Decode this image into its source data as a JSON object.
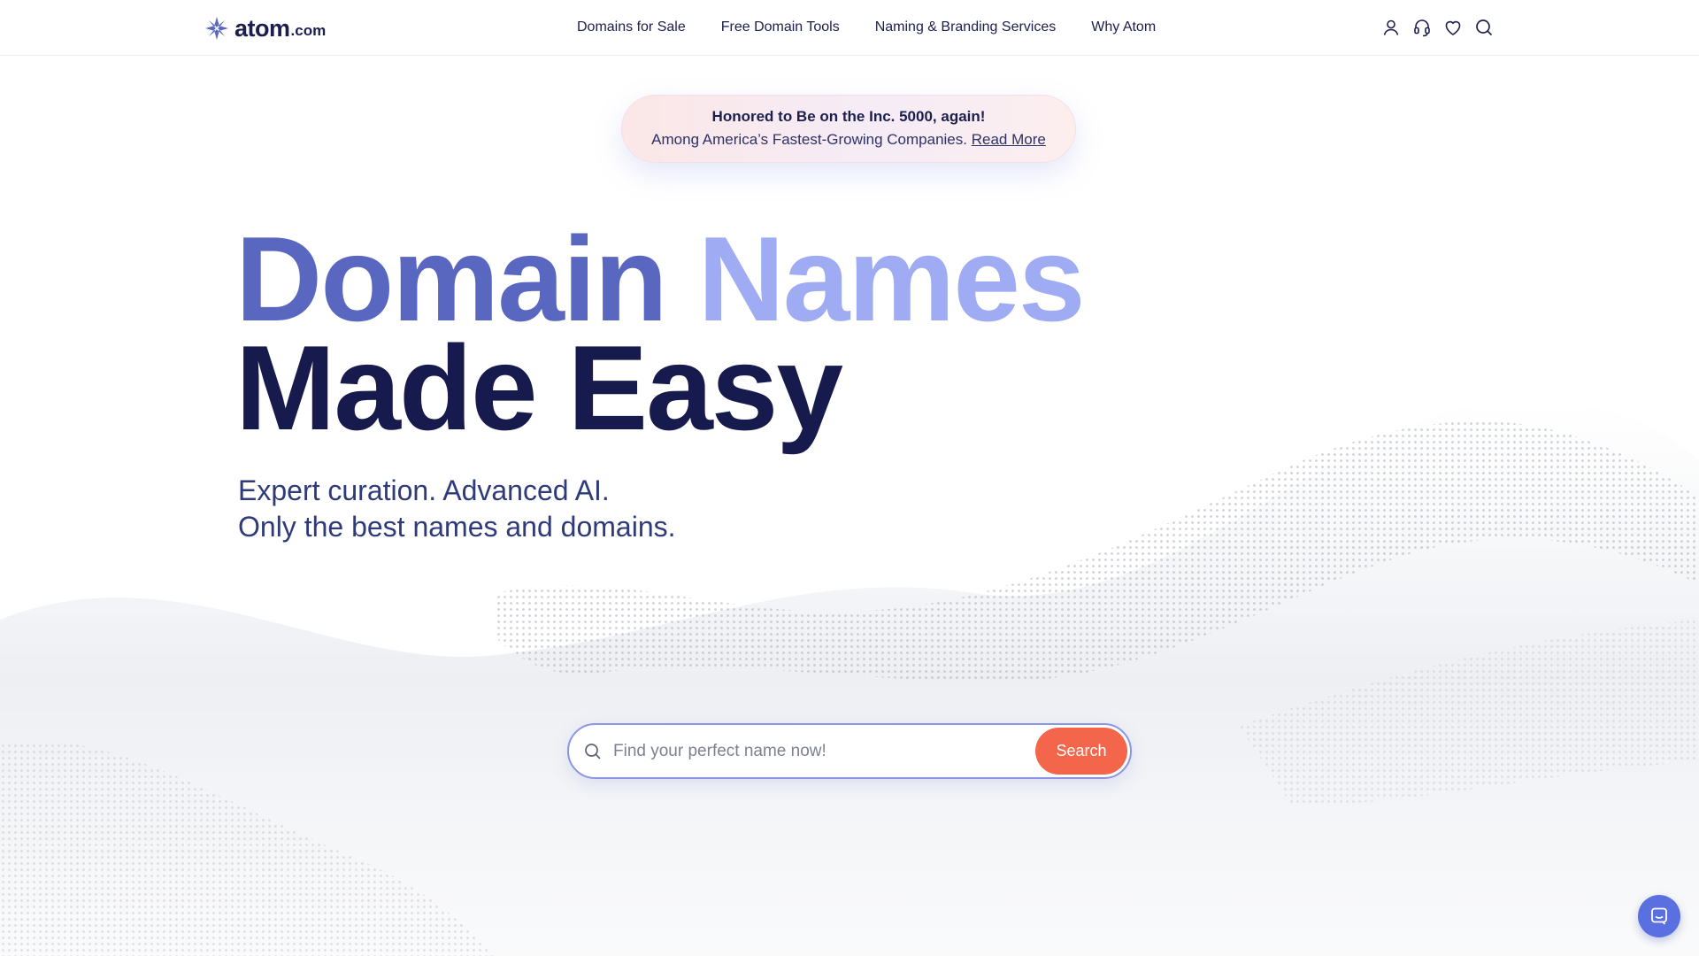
{
  "logo": {
    "word": "atom",
    "tld": ".com",
    "icon": "atom-star-logo-icon"
  },
  "nav": {
    "items": [
      {
        "label": "Domains for Sale"
      },
      {
        "label": "Free Domain Tools"
      },
      {
        "label": "Naming & Branding Services"
      },
      {
        "label": "Why Atom"
      }
    ]
  },
  "header_icons": [
    "user-icon",
    "headset-icon",
    "heart-icon",
    "search-icon"
  ],
  "award": {
    "title": "Honored to Be on the Inc. 5000, again!",
    "subtitle": "Among America’s Fastest-Growing Companies.",
    "link": "Read More"
  },
  "hero": {
    "line1_a": "Domain",
    "line1_b": "Names",
    "line2": "Made Easy",
    "sub1": "Expert curation. Advanced AI.",
    "sub2": "Only the best names and domains."
  },
  "search": {
    "placeholder": "Find your perfect name now!",
    "button": "Search"
  },
  "colors": {
    "brand_dark": "#1c1f4d",
    "hero_blue": "#5a67c0",
    "hero_light": "#9fabf2",
    "search_button": "#f4664c",
    "chat_button": "#5a6fe0"
  },
  "chat": {
    "icon": "chat-bubble-icon"
  }
}
